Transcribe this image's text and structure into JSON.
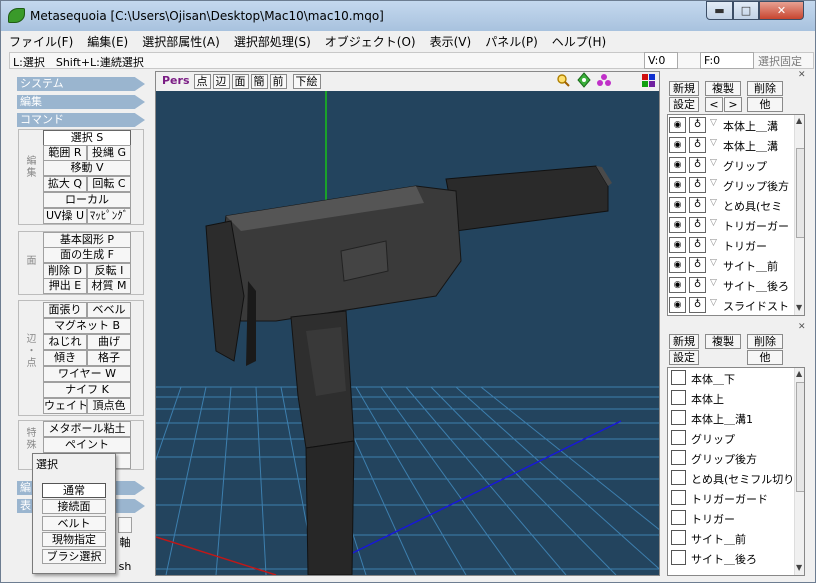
{
  "window": {
    "title": "Metasequoia [C:\\Users\\Ojisan\\Desktop\\Mac10\\mac10.mqo]",
    "min_glyph": "▬",
    "max_glyph": "□",
    "close_glyph": "✕"
  },
  "menu": [
    "ファイル(F)",
    "編集(E)",
    "選択部属性(A)",
    "選択部処理(S)",
    "オブジェクト(O)",
    "表示(V)",
    "パネル(P)",
    "ヘルプ(H)"
  ],
  "status": {
    "hint": "L:選択　Shift+L:連続選択",
    "v_count": "V:0",
    "f_count": "F:0",
    "fixed_selection": "選択固定"
  },
  "left_panel": {
    "sections": [
      "システム",
      "編集",
      "コマンド"
    ],
    "edit_group_label": "編集",
    "face_group_label": "面",
    "edge_group_label": "辺・点",
    "special_group_label": "特殊",
    "buttons": {
      "select": "選択 S",
      "range": "範囲 R",
      "lasso": "投縄 G",
      "move": "移動 V",
      "scale": "拡大 Q",
      "rotate": "回転 C",
      "local": "ローカル",
      "uv": "UV操 U",
      "mapping": "ﾏｯﾋﾟﾝｸﾞ",
      "primitive": "基本図形 P",
      "make_face": "面の生成 F",
      "delete": "削除 D",
      "invert": "反転 I",
      "extrude": "押出 E",
      "material": "材質 M",
      "face_stretch": "面張り",
      "bevel": "ベベル",
      "magnet": "マグネット B",
      "twist": "ねじれ",
      "bend": "曲げ",
      "tilt": "傾き",
      "lattice": "格子",
      "wire": "ワイヤー W",
      "knife": "ナイフ K",
      "weight": "ウェイト",
      "vertex_color": "頂点色",
      "metaball": "メタボール粘土",
      "paint": "ペイント",
      "axis": "軸",
      "sh": "sh"
    },
    "bottom_sections": [
      "編",
      "表"
    ]
  },
  "select_popup": {
    "title": "選択",
    "items": [
      "通常",
      "接続面",
      "ベルト",
      "現物指定",
      "ブラシ選択"
    ]
  },
  "viewport": {
    "toolbar": [
      "Pers",
      "点",
      "辺",
      "面",
      "簡",
      "前",
      "下絵"
    ]
  },
  "object_panel": {
    "buttons": {
      "new": "新規",
      "copy": "複製",
      "delete": "削除",
      "settings": "設定",
      "prev": "<",
      "next": ">",
      "other": "他"
    },
    "eye_glyph": "◉",
    "lock_glyph": "♁",
    "expand_glyph": "▽",
    "objects": [
      "本体上＿溝",
      "本体上＿溝",
      "グリップ",
      "グリップ後方",
      "とめ具(セミ",
      "トリガーガー",
      "トリガー",
      "サイト＿前",
      "サイト＿後ろ",
      "スライドスト"
    ]
  },
  "material_panel": {
    "buttons": {
      "new": "新規",
      "copy": "複製",
      "delete": "削除",
      "settings": "設定",
      "other": "他"
    },
    "materials": [
      "本体＿下",
      "本体上",
      "本体上＿溝1",
      "グリップ",
      "グリップ後方",
      "とめ具(セミフル切り",
      "トリガーガード",
      "トリガー",
      "サイト＿前",
      "サイト＿後ろ"
    ]
  },
  "colors": {
    "viewport_bg": "#23445e",
    "grid": "#3d7fae",
    "gun_body": "#3a3a3a",
    "x_axis": "#c01818",
    "y_axis": "#18c018",
    "z_axis": "#1818d8",
    "section_header": "#9ab5cf"
  }
}
